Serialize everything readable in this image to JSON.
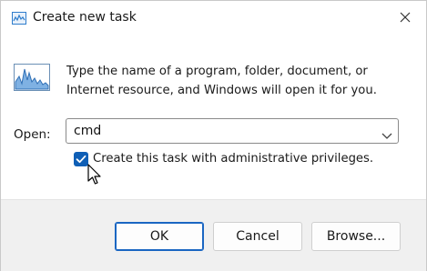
{
  "window": {
    "title": "Create new task"
  },
  "description": {
    "line1": "Type the name of a program, folder, document, or",
    "line2": "Internet resource, and Windows will open it for you."
  },
  "open": {
    "label": "Open:",
    "value": "cmd"
  },
  "admin_checkbox": {
    "label": "Create this task with administrative privileges.",
    "checked": true
  },
  "buttons": {
    "ok": "OK",
    "cancel": "Cancel",
    "browse": "Browse..."
  },
  "icons": {
    "title": "task-manager-icon",
    "close": "close-icon",
    "program": "performance-graph-icon",
    "dropdown": "chevron-down-icon",
    "check": "checkmark-icon",
    "cursor": "mouse-pointer-icon"
  },
  "colors": {
    "accent": "#0f5fb6",
    "footer_bg": "#f0f0f0"
  }
}
